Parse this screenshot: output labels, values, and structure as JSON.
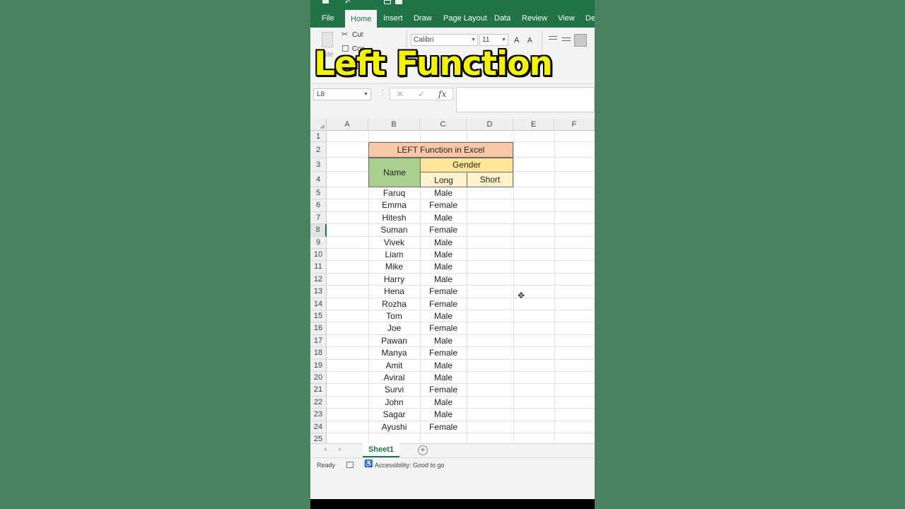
{
  "banner": "Left Function",
  "ribbon": {
    "tabs": [
      "File",
      "Home",
      "Insert",
      "Draw",
      "Page Layout",
      "Data",
      "Review",
      "View",
      "De"
    ],
    "active_tab": "Home",
    "cut_label": "Cut",
    "copy_label": "Cop",
    "paste_label": "ste",
    "font_name": "Calibri",
    "font_size": "11",
    "grow_font": "A",
    "shrink_font": "A"
  },
  "formula_bar": {
    "name_box": "L8",
    "fx": "fx",
    "cancel": "✕",
    "enter": "✓",
    "formula": ""
  },
  "columns": [
    "A",
    "B",
    "C",
    "D",
    "E",
    "F"
  ],
  "rows": [
    "1",
    "2",
    "3",
    "4",
    "5",
    "6",
    "7",
    "8",
    "9",
    "10",
    "11",
    "12",
    "13",
    "14",
    "15",
    "16",
    "17",
    "18",
    "19",
    "20",
    "21",
    "22",
    "23",
    "24",
    "25"
  ],
  "selected_row": "8",
  "table": {
    "title": "LEFT Function in Excel",
    "name_header": "Name",
    "gender_header": "Gender",
    "long_header": "Long",
    "short_header": "Short",
    "records": [
      {
        "name": "Faruq",
        "long": "Male",
        "short": ""
      },
      {
        "name": "Emma",
        "long": "Female",
        "short": ""
      },
      {
        "name": "Hitesh",
        "long": "Male",
        "short": ""
      },
      {
        "name": "Suman",
        "long": "Female",
        "short": ""
      },
      {
        "name": "Vivek",
        "long": "Male",
        "short": ""
      },
      {
        "name": "Liam",
        "long": "Male",
        "short": ""
      },
      {
        "name": "Mike",
        "long": "Male",
        "short": ""
      },
      {
        "name": "Harry",
        "long": "Male",
        "short": ""
      },
      {
        "name": "Hena",
        "long": "Female",
        "short": ""
      },
      {
        "name": "Rozha",
        "long": "Female",
        "short": ""
      },
      {
        "name": "Tom",
        "long": "Male",
        "short": ""
      },
      {
        "name": "Joe",
        "long": "Female",
        "short": ""
      },
      {
        "name": "Pawan",
        "long": "Male",
        "short": ""
      },
      {
        "name": "Manya",
        "long": "Female",
        "short": ""
      },
      {
        "name": "Amit",
        "long": "Male",
        "short": ""
      },
      {
        "name": "Aviral",
        "long": "Male",
        "short": ""
      },
      {
        "name": "Survi",
        "long": "Female",
        "short": ""
      },
      {
        "name": "John",
        "long": "Male",
        "short": ""
      },
      {
        "name": "Sagar",
        "long": "Male",
        "short": ""
      },
      {
        "name": "Ayushi",
        "long": "Female",
        "short": ""
      }
    ]
  },
  "sheet_tab": "Sheet1",
  "status": {
    "ready": "Ready",
    "accessibility": "Accessibility: Good to go"
  },
  "colors": {
    "excel_green": "#217346",
    "title_fill": "#f8c8a8",
    "name_fill": "#a9d08e",
    "gender_fill": "#ffe699",
    "long_short_fill": "#fff2cc",
    "background": "#4a8260",
    "banner_text": "#f5f200"
  }
}
